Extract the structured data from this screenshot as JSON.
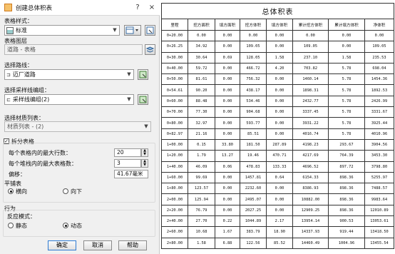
{
  "window": {
    "title": "创建总体积表",
    "help": "?",
    "close": "×"
  },
  "style": {
    "label": "表格样式：",
    "value": "标准"
  },
  "layer": {
    "label": "表格图层",
    "value": "道路 - 表格"
  },
  "route": {
    "label": "选择路线：",
    "value": "迈厂道路"
  },
  "sample_group": {
    "label": "选择采样线编组：",
    "value": "采样线编组(2)"
  },
  "material_list": {
    "label": "选择材质列表：",
    "value": "材质列表 - (2)"
  },
  "split": {
    "label": "拆分表格",
    "checked": true,
    "max_rows_label": "每个表格内的最大行数：",
    "max_rows": "20",
    "max_stack_label": "每个堆栈内的最大表格数：",
    "max_stack": "3",
    "offset_label": "偏移：",
    "offset": "41.67毫米"
  },
  "tile": {
    "label": "平铺表",
    "across": "横向",
    "down": "向下"
  },
  "behavior": {
    "label": "行为",
    "reaction_label": "反应模式：",
    "static": "静态",
    "dynamic": "动态"
  },
  "buttons": {
    "ok": "确定",
    "cancel": "取消",
    "help": "帮助"
  },
  "volume_table": {
    "title": "总体积表",
    "headers": [
      "里程",
      "挖方面积",
      "填方面积",
      "挖方体积",
      "填方体积",
      "累计挖方体积",
      "累计填方体积",
      "净体积"
    ],
    "rows": [
      [
        "0+20.00",
        "0.00",
        "0.00",
        "0.00",
        "0.00",
        "0.00",
        "0.00",
        "0.00"
      ],
      [
        "0+26.25",
        "34.92",
        "0.00",
        "109.05",
        "0.00",
        "109.05",
        "0.00",
        "109.05"
      ],
      [
        "0+30.00",
        "30.64",
        "0.69",
        "128.05",
        "1.58",
        "237.10",
        "1.58",
        "235.53"
      ],
      [
        "0+40.00",
        "59.72",
        "0.00",
        "466.72",
        "4.20",
        "703.82",
        "5.78",
        "698.04"
      ],
      [
        "0+50.00",
        "81.61",
        "0.00",
        "756.32",
        "0.00",
        "1460.14",
        "5.78",
        "1454.36"
      ],
      [
        "0+54.61",
        "90.20",
        "0.00",
        "438.17",
        "0.00",
        "1898.31",
        "5.78",
        "1892.53"
      ],
      [
        "0+60.00",
        "88.48",
        "0.00",
        "534.46",
        "0.00",
        "2432.77",
        "5.78",
        "2426.99"
      ],
      [
        "0+70.00",
        "77.30",
        "0.00",
        "904.68",
        "0.00",
        "3337.45",
        "5.78",
        "3331.67"
      ],
      [
        "0+80.00",
        "32.97",
        "0.00",
        "593.77",
        "0.00",
        "3931.22",
        "5.78",
        "3925.44"
      ],
      [
        "0+82.97",
        "21.16",
        "0.00",
        "85.51",
        "0.00",
        "4016.74",
        "5.78",
        "4010.96"
      ],
      [
        "1+00.00",
        "0.15",
        "33.80",
        "181.50",
        "287.89",
        "4198.23",
        "293.67",
        "3904.56"
      ],
      [
        "1+20.00",
        "1.79",
        "13.27",
        "19.46",
        "470.71",
        "4217.69",
        "764.39",
        "3453.30"
      ],
      [
        "1+40.00",
        "46.09",
        "0.06",
        "478.83",
        "133.33",
        "4696.52",
        "897.72",
        "3798.80"
      ],
      [
        "1+60.00",
        "99.69",
        "0.00",
        "1457.81",
        "0.64",
        "6154.33",
        "898.36",
        "5255.97"
      ],
      [
        "1+80.00",
        "123.57",
        "0.00",
        "2232.60",
        "0.00",
        "8386.93",
        "898.36",
        "7488.57"
      ],
      [
        "2+00.00",
        "125.94",
        "0.00",
        "2495.07",
        "0.00",
        "10882.00",
        "898.36",
        "9983.64"
      ],
      [
        "2+20.00",
        "76.79",
        "0.00",
        "2027.25",
        "0.00",
        "12909.25",
        "898.36",
        "12010.89"
      ],
      [
        "2+40.00",
        "27.70",
        "0.22",
        "1044.89",
        "2.17",
        "13954.14",
        "900.53",
        "13053.61"
      ],
      [
        "2+60.00",
        "10.68",
        "1.67",
        "383.79",
        "18.90",
        "14337.93",
        "919.44",
        "13418.50"
      ],
      [
        "2+80.00",
        "1.58",
        "6.88",
        "122.56",
        "85.52",
        "14460.49",
        "1004.96",
        "13455.54"
      ]
    ]
  }
}
